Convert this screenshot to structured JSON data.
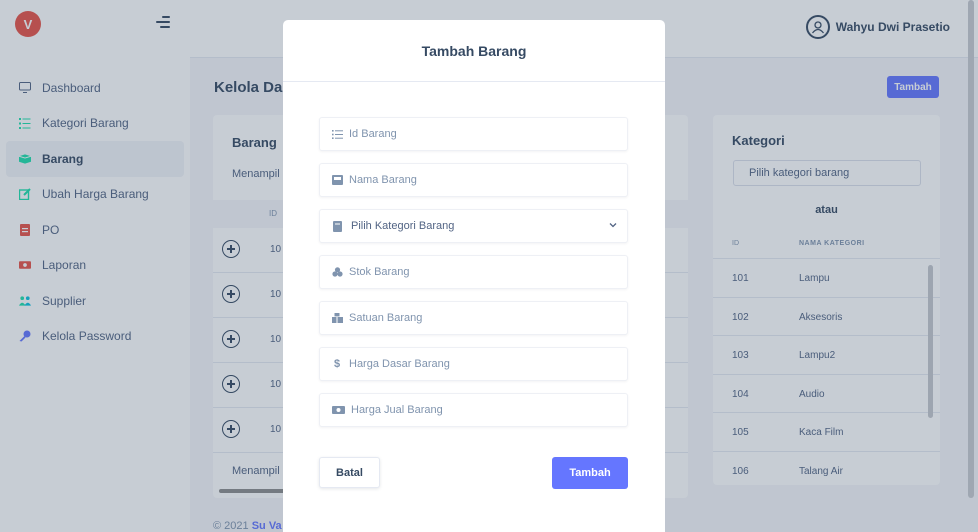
{
  "brand": {
    "logo_letter": "V"
  },
  "sidebar": {
    "items": [
      {
        "label": "Dashboard",
        "icon": "monitor-icon"
      },
      {
        "label": "Kategori Barang",
        "icon": "list-icon"
      },
      {
        "label": "Barang",
        "icon": "box-icon",
        "active": true
      },
      {
        "label": "Ubah Harga Barang",
        "icon": "edit-icon"
      },
      {
        "label": "PO",
        "icon": "file-icon"
      },
      {
        "label": "Laporan",
        "icon": "money-icon"
      },
      {
        "label": "Supplier",
        "icon": "users-icon"
      },
      {
        "label": "Kelola Password",
        "icon": "key-icon"
      }
    ]
  },
  "header": {
    "user_name": "Wahyu Dwi Prasetio"
  },
  "page": {
    "title": "Kelola Da",
    "add_button": "Tambah"
  },
  "barang_card": {
    "title": "Barang",
    "subtitle": "Menampil",
    "column_id": "ID",
    "rows": [
      "10",
      "10",
      "10",
      "10",
      "10"
    ],
    "footer": "Menampil"
  },
  "kategori_card": {
    "title": "Kategori",
    "select_placeholder": "Pilih kategori barang",
    "atau": "atau",
    "columns": {
      "id": "ID",
      "nama": "NAMA KATEGORI"
    },
    "rows": [
      {
        "id": "101",
        "nama": "Lampu"
      },
      {
        "id": "102",
        "nama": "Aksesoris"
      },
      {
        "id": "103",
        "nama": "Lampu2"
      },
      {
        "id": "104",
        "nama": "Audio"
      },
      {
        "id": "105",
        "nama": "Kaca Film"
      },
      {
        "id": "106",
        "nama": "Talang Air"
      }
    ]
  },
  "footer": {
    "copyright": "© 2021",
    "brand": "Su Va"
  },
  "modal": {
    "title": "Tambah Barang",
    "fields": {
      "id": "Id Barang",
      "nama": "Nama Barang",
      "kategori": "Pilih Kategori Barang",
      "stok": "Stok Barang",
      "satuan": "Satuan Barang",
      "harga_dasar": "Harga Dasar Barang",
      "harga_jual": "Harga Jual Barang"
    },
    "cancel_label": "Batal",
    "submit_label": "Tambah"
  },
  "colors": {
    "accent": "#6576ff",
    "brand": "#e85347",
    "text": "#364a63"
  }
}
